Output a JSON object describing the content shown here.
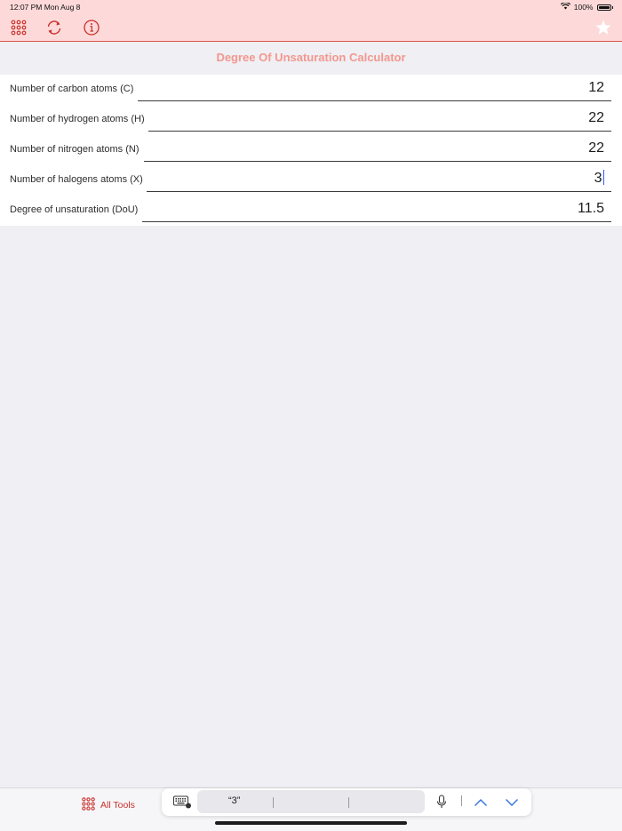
{
  "status": {
    "time": "12:07 PM  Mon Aug 8",
    "battery": "100%"
  },
  "toolbar": {
    "icons": [
      "grid-icon",
      "refresh-icon",
      "info-icon",
      "star-icon"
    ],
    "accent": "#c9302c"
  },
  "title": "Degree Of Unsaturation Calculator",
  "fields": [
    {
      "label": "Number of carbon atoms (C)",
      "value": "12"
    },
    {
      "label": "Number of hydrogen atoms (H)",
      "value": "22"
    },
    {
      "label": "Number of nitrogen atoms (N)",
      "value": "22"
    },
    {
      "label": "Number of halogens atoms (X)",
      "value": "3"
    },
    {
      "label": "Degree of unsaturation (DoU)",
      "value": "11.5"
    }
  ],
  "bottom": {
    "all_tools_label": "All Tools",
    "suggestion": "“3”"
  }
}
